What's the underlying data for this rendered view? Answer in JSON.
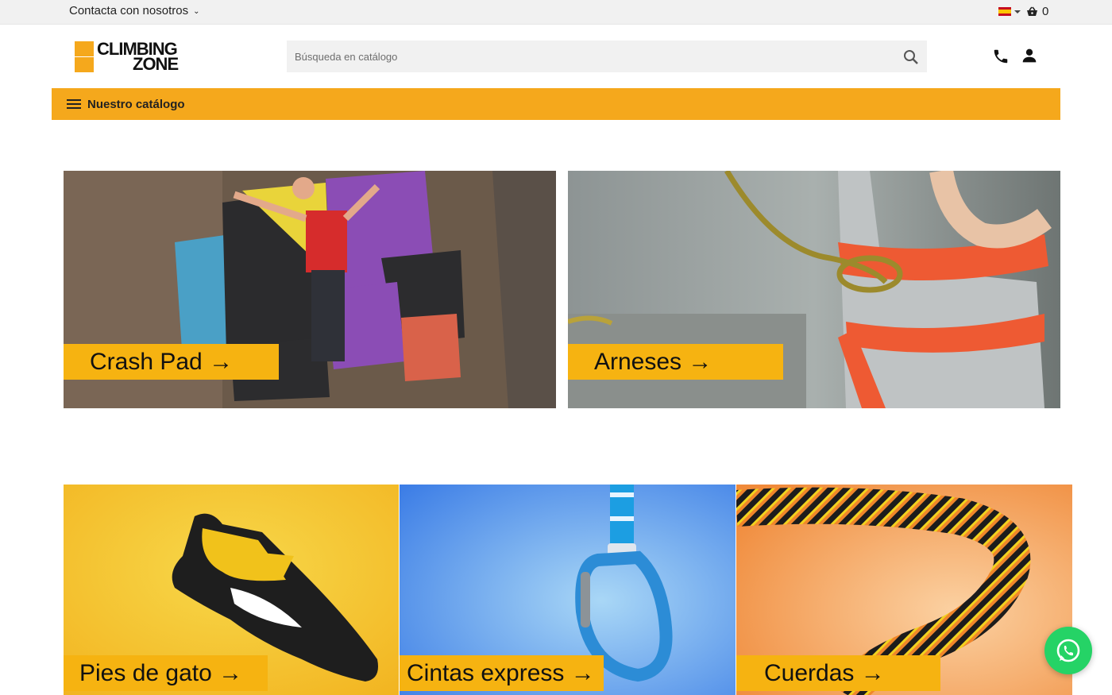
{
  "topbar": {
    "contact_label": "Contacta con nosotros",
    "language": "es",
    "cart_count": "0"
  },
  "header": {
    "logo_line1": "CLIMBING",
    "logo_line2": "ZONE",
    "search_placeholder": "Búsqueda en catálogo"
  },
  "nav": {
    "catalog_label": "Nuestro catálogo"
  },
  "banners": [
    {
      "label": "Crash Pad →"
    },
    {
      "label": "Arneses →"
    },
    {
      "label": "Pies de gato →"
    },
    {
      "label": "Cintas express →"
    },
    {
      "label": "Cuerdas →"
    }
  ],
  "colors": {
    "accent": "#f5a81c",
    "tag": "#f6b311",
    "whatsapp": "#25d366"
  },
  "icons": [
    "chevron-down-icon",
    "flag-icon",
    "basket-icon",
    "search-icon",
    "phone-icon",
    "user-icon",
    "menu-icon",
    "whatsapp-icon"
  ]
}
